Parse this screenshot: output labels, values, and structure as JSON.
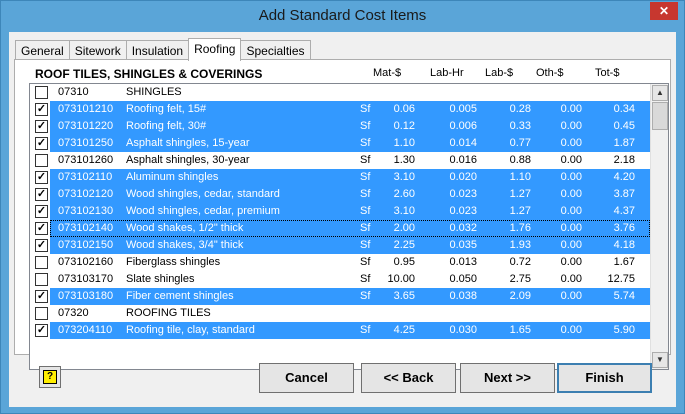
{
  "window": {
    "title": "Add Standard Cost Items",
    "close_glyph": "✕"
  },
  "tabs": [
    {
      "label": "General",
      "active": false
    },
    {
      "label": "Sitework",
      "active": false
    },
    {
      "label": "Insulation",
      "active": false
    },
    {
      "label": "Roofing",
      "active": true
    },
    {
      "label": "Specialties",
      "active": false
    }
  ],
  "list": {
    "heading": "ROOF TILES, SHINGLES & COVERINGS",
    "columns": {
      "mat": "Mat-$",
      "lab_hr": "Lab-Hr",
      "lab": "Lab-$",
      "oth": "Oth-$",
      "tot": "Tot-$"
    },
    "rows": [
      {
        "checked": false,
        "selected": false,
        "code": "07310",
        "desc": "SHINGLES",
        "unit": "",
        "mat": "",
        "lab_hr": "",
        "lab": "",
        "oth": "",
        "tot": ""
      },
      {
        "checked": true,
        "selected": true,
        "code": "073101210",
        "desc": "Roofing felt, 15#",
        "unit": "Sf",
        "mat": "0.06",
        "lab_hr": "0.005",
        "lab": "0.28",
        "oth": "0.00",
        "tot": "0.34"
      },
      {
        "checked": true,
        "selected": true,
        "code": "073101220",
        "desc": "Roofing felt, 30#",
        "unit": "Sf",
        "mat": "0.12",
        "lab_hr": "0.006",
        "lab": "0.33",
        "oth": "0.00",
        "tot": "0.45"
      },
      {
        "checked": true,
        "selected": true,
        "code": "073101250",
        "desc": "Asphalt shingles, 15-year",
        "unit": "Sf",
        "mat": "1.10",
        "lab_hr": "0.014",
        "lab": "0.77",
        "oth": "0.00",
        "tot": "1.87"
      },
      {
        "checked": false,
        "selected": false,
        "code": "073101260",
        "desc": "Asphalt shingles, 30-year",
        "unit": "Sf",
        "mat": "1.30",
        "lab_hr": "0.016",
        "lab": "0.88",
        "oth": "0.00",
        "tot": "2.18"
      },
      {
        "checked": true,
        "selected": true,
        "code": "073102110",
        "desc": "Aluminum shingles",
        "unit": "Sf",
        "mat": "3.10",
        "lab_hr": "0.020",
        "lab": "1.10",
        "oth": "0.00",
        "tot": "4.20"
      },
      {
        "checked": true,
        "selected": true,
        "code": "073102120",
        "desc": "Wood shingles, cedar, standard",
        "unit": "Sf",
        "mat": "2.60",
        "lab_hr": "0.023",
        "lab": "1.27",
        "oth": "0.00",
        "tot": "3.87"
      },
      {
        "checked": true,
        "selected": true,
        "code": "073102130",
        "desc": "Wood shingles, cedar, premium",
        "unit": "Sf",
        "mat": "3.10",
        "lab_hr": "0.023",
        "lab": "1.27",
        "oth": "0.00",
        "tot": "4.37"
      },
      {
        "checked": true,
        "selected": true,
        "focus": true,
        "code": "073102140",
        "desc": "Wood shakes, 1/2\" thick",
        "unit": "Sf",
        "mat": "2.00",
        "lab_hr": "0.032",
        "lab": "1.76",
        "oth": "0.00",
        "tot": "3.76"
      },
      {
        "checked": true,
        "selected": true,
        "code": "073102150",
        "desc": "Wood shakes, 3/4\" thick",
        "unit": "Sf",
        "mat": "2.25",
        "lab_hr": "0.035",
        "lab": "1.93",
        "oth": "0.00",
        "tot": "4.18"
      },
      {
        "checked": false,
        "selected": false,
        "code": "073102160",
        "desc": "Fiberglass shingles",
        "unit": "Sf",
        "mat": "0.95",
        "lab_hr": "0.013",
        "lab": "0.72",
        "oth": "0.00",
        "tot": "1.67"
      },
      {
        "checked": false,
        "selected": false,
        "code": "073103170",
        "desc": "Slate shingles",
        "unit": "Sf",
        "mat": "10.00",
        "lab_hr": "0.050",
        "lab": "2.75",
        "oth": "0.00",
        "tot": "12.75"
      },
      {
        "checked": true,
        "selected": true,
        "code": "073103180",
        "desc": "Fiber cement shingles",
        "unit": "Sf",
        "mat": "3.65",
        "lab_hr": "0.038",
        "lab": "2.09",
        "oth": "0.00",
        "tot": "5.74"
      },
      {
        "checked": false,
        "selected": false,
        "code": "07320",
        "desc": "ROOFING TILES",
        "unit": "",
        "mat": "",
        "lab_hr": "",
        "lab": "",
        "oth": "",
        "tot": ""
      },
      {
        "checked": true,
        "selected": true,
        "code": "073204110",
        "desc": "Roofing tile, clay, standard",
        "unit": "Sf",
        "mat": "4.25",
        "lab_hr": "0.030",
        "lab": "1.65",
        "oth": "0.00",
        "tot": "5.90"
      }
    ]
  },
  "buttons": {
    "cancel": "Cancel",
    "back": "<< Back",
    "next": "Next >>",
    "finish": "Finish"
  },
  "help": {
    "glyph": "?"
  },
  "scrollbar": {
    "up_glyph": "▲",
    "down_glyph": "▼"
  },
  "colors": {
    "selection": "#3399ff",
    "titlebar": "#5aa5d8",
    "close": "#c7372f"
  }
}
